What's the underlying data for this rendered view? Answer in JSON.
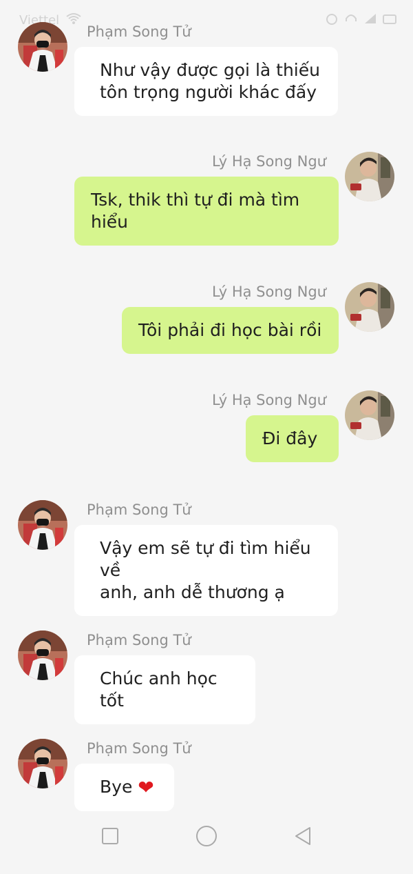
{
  "status_bar": {
    "carrier": "Viettel",
    "icons": [
      "wifi-icon",
      "alarm-icon",
      "headphones-icon",
      "signal-icon",
      "battery-icon"
    ]
  },
  "contacts": {
    "other": {
      "name": "Phạm Song Tử",
      "avatar": "person-in-mask-avatar"
    },
    "me": {
      "name": "Lý Hạ Song Ngư",
      "avatar": "person-reading-avatar"
    }
  },
  "messages": [
    {
      "sender": "Phạm Song Tử",
      "direction": "in",
      "lines": [
        "Như vậy được gọi là thiếu",
        "tôn trọng người khác đấy"
      ]
    },
    {
      "sender": "Lý Hạ Song Ngư",
      "direction": "out",
      "lines": [
        "Tsk, thik thì tự đi mà tìm",
        "hiểu"
      ]
    },
    {
      "sender": "Lý Hạ Song Ngư",
      "direction": "out",
      "lines": [
        "Tôi phải đi học bài rồi"
      ]
    },
    {
      "sender": "Lý Hạ Song Ngư",
      "direction": "out",
      "lines": [
        "Đi đây"
      ]
    },
    {
      "sender": "Phạm Song Tử",
      "direction": "in",
      "lines": [
        "Vậy em sẽ tự đi tìm hiểu về",
        "anh, anh dễ thương ạ"
      ]
    },
    {
      "sender": "Phạm Song Tử",
      "direction": "in",
      "lines": [
        "Chúc anh học tốt"
      ]
    },
    {
      "sender": "Phạm Song Tử",
      "direction": "in",
      "lines": [
        "Bye"
      ],
      "emoji": "❤"
    }
  ],
  "colors": {
    "background": "#f5f5f5",
    "incoming_bubble": "#ffffff",
    "outgoing_bubble": "#d6f58e",
    "name_text": "#8f8f8f"
  },
  "nav_bar": {
    "buttons": [
      "recent-apps-icon",
      "home-icon",
      "back-icon"
    ]
  }
}
